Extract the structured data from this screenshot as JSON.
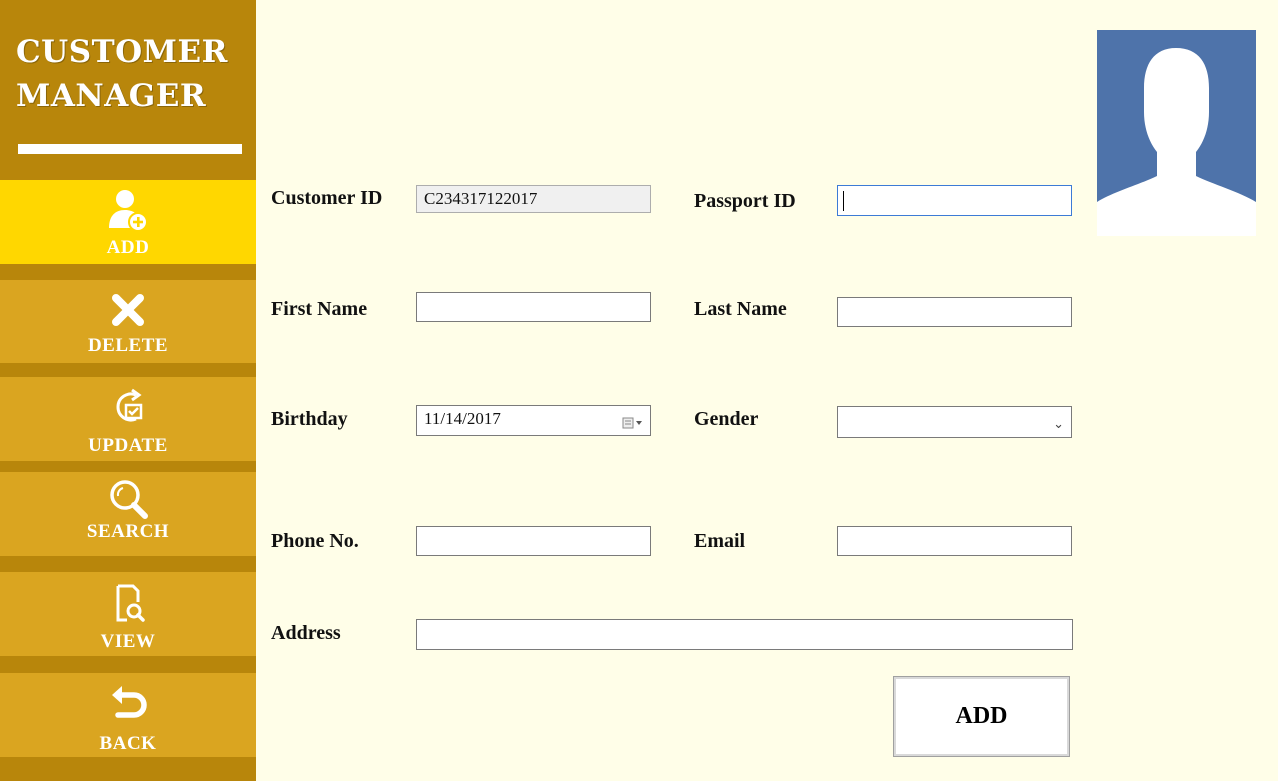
{
  "app": {
    "title_line1": "CUSTOMER",
    "title_line2": "MANAGER"
  },
  "sidebar": {
    "items": [
      {
        "label": "ADD",
        "icon": "add-user-icon",
        "active": true
      },
      {
        "label": "DELETE",
        "icon": "close-icon",
        "active": false
      },
      {
        "label": "UPDATE",
        "icon": "update-icon",
        "active": false
      },
      {
        "label": "SEARCH",
        "icon": "search-icon",
        "active": false
      },
      {
        "label": "VIEW",
        "icon": "view-document-icon",
        "active": false
      },
      {
        "label": "BACK",
        "icon": "back-arrow-icon",
        "active": false
      }
    ]
  },
  "form": {
    "customer_id": {
      "label": "Customer ID",
      "value": "C234317122017"
    },
    "passport_id": {
      "label": "Passport ID",
      "value": ""
    },
    "first_name": {
      "label": "First Name",
      "value": ""
    },
    "last_name": {
      "label": "Last Name",
      "value": ""
    },
    "birthday": {
      "label": "Birthday",
      "value": "11/14/2017"
    },
    "gender": {
      "label": "Gender",
      "value": ""
    },
    "phone": {
      "label": "Phone No.",
      "value": ""
    },
    "email": {
      "label": "Email",
      "value": ""
    },
    "address": {
      "label": "Address",
      "value": ""
    },
    "submit_label": "ADD"
  },
  "colors": {
    "sidebar_bg": "#b8860b",
    "nav_active": "#ffd700",
    "nav_normal": "#daa520",
    "page_bg": "#fffee8",
    "avatar_bg": "#4e73aa"
  }
}
